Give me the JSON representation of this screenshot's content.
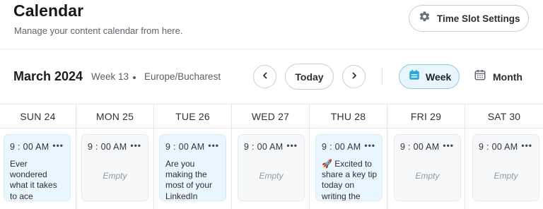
{
  "header": {
    "title": "Calendar",
    "subtitle": "Manage your content calendar from here.",
    "time_slot_button": "Time Slot Settings"
  },
  "toolbar": {
    "month_label": "March 2024",
    "week_label": "Week 13",
    "timezone": "Europe/Bucharest",
    "today_label": "Today",
    "views": {
      "week": "Week",
      "month": "Month",
      "active": "week"
    }
  },
  "colors": {
    "accent_bg": "#e8f5fc",
    "accent_border": "#8ec9e6",
    "empty_slot": "#f7f8f9",
    "filled_slot": "#e9f6fd"
  },
  "days": [
    {
      "label": "SUN 24",
      "slot": {
        "time": "9 : 00 AM",
        "more": "•••",
        "text": "Ever wondered what it takes to ace",
        "empty_label": ""
      }
    },
    {
      "label": "MON 25",
      "slot": {
        "time": "9 : 00 AM",
        "more": "•••",
        "text": "",
        "empty_label": "Empty"
      }
    },
    {
      "label": "TUE 26",
      "slot": {
        "time": "9 : 00 AM",
        "more": "•••",
        "text": "Are you making the most of your LinkedIn",
        "empty_label": ""
      }
    },
    {
      "label": "WED 27",
      "slot": {
        "time": "9 : 00 AM",
        "more": "•••",
        "text": "",
        "empty_label": "Empty"
      }
    },
    {
      "label": "THU 28",
      "slot": {
        "time": "9 : 00 AM",
        "more": "•••",
        "text": "🚀 Excited to share a key tip today on writing the",
        "empty_label": ""
      }
    },
    {
      "label": "FRI 29",
      "slot": {
        "time": "9 : 00 AM",
        "more": "•••",
        "text": "",
        "empty_label": "Empty"
      }
    },
    {
      "label": "SAT 30",
      "slot": {
        "time": "9 : 00 AM",
        "more": "•••",
        "text": "",
        "empty_label": "Empty"
      }
    }
  ]
}
